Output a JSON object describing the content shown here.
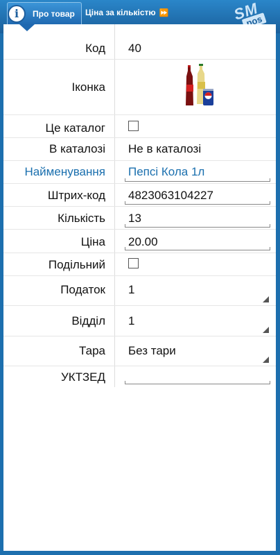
{
  "header": {
    "tab_active_label": "Про товар",
    "tab_active_icon": "info-icon",
    "tab_next_label": "Ціна за кількістю",
    "tab_next_icon": "fast-forward-icon",
    "logo_line1": "SM",
    "logo_line2": "pos"
  },
  "form": {
    "code": {
      "label": "Код",
      "value": "40"
    },
    "icon": {
      "label": "Іконка",
      "image": "cola-pepsi-bottles-image"
    },
    "is_catalog": {
      "label": "Це каталог",
      "checked": false
    },
    "in_catalog": {
      "label": "В каталозі",
      "value": "Не в каталозі"
    },
    "name": {
      "label": "Найменування",
      "value": "Пепсі Кола 1л"
    },
    "barcode": {
      "label": "Штрих-код",
      "value": "4823063104227"
    },
    "quantity": {
      "label": "Кількість",
      "value": "13"
    },
    "price": {
      "label": "Ціна",
      "value": "20.00"
    },
    "divisible": {
      "label": "Подільний",
      "checked": false
    },
    "tax": {
      "label": "Податок",
      "value": "1"
    },
    "department": {
      "label": "Відділ",
      "value": "1"
    },
    "container": {
      "label": "Тара",
      "value": "Без тари"
    },
    "uktzed": {
      "label": "УКТЗЕД",
      "value": ""
    }
  }
}
